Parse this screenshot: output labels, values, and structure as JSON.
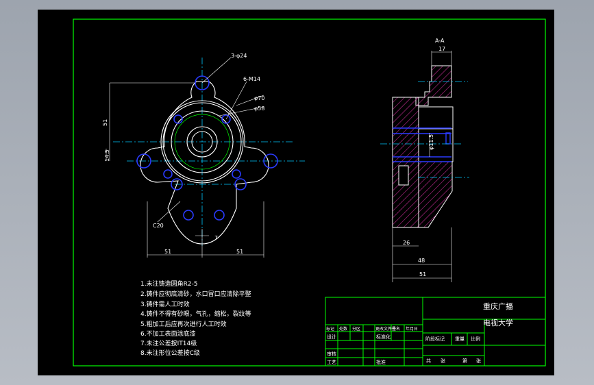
{
  "drawing": {
    "section_label": "A-A",
    "front_dims": {
      "holes": "3-φ24",
      "threads": "6-M14",
      "bolt_circle": "φ70",
      "bore": "φ58",
      "height": "51",
      "offset": "14.5",
      "fillet": "C20",
      "small_gap": "7",
      "half_width_left": "51",
      "half_width_right": "51"
    },
    "section_dims": {
      "top_width": "17",
      "thread": "φ11.5",
      "inner": "26",
      "middle": "48",
      "total": "51"
    },
    "notes": [
      "1.未注铸造圆角R2-5",
      "2.铸件应彻底清砂，水口冒口应清除平整",
      "3.铸件需人工时效",
      "4.铸件不得有砂眼，气孔，缩松，裂纹等",
      "5.粗加工后应再次进行人工时效",
      "6.不加工表面涂底漆",
      "7.未注公差按IT14级",
      "8.未注形位公差按C级"
    ]
  },
  "title_block": {
    "school_line1": "重庆广播",
    "school_line2": "电视大学",
    "rev_headers": [
      "标记",
      "处数",
      "分区",
      "更改文件号",
      "签名",
      "年月日"
    ],
    "row_design": "设计",
    "row_standard": "标准化",
    "row_check": "审核",
    "row_process": "工艺",
    "row_approve": "批准",
    "stage_headers": [
      "阶段标记",
      "重量",
      "比例"
    ],
    "sheet_total_label": "共",
    "sheet_total_unit": "张",
    "sheet_no_label": "第",
    "sheet_no_unit": "张"
  },
  "colors": {
    "border": "#00ff00",
    "outline": "#ffffff",
    "hole": "#2a3bff",
    "center_line": "#00c8ff",
    "hatch": "#b0208a",
    "dimension": "#ffffff"
  }
}
